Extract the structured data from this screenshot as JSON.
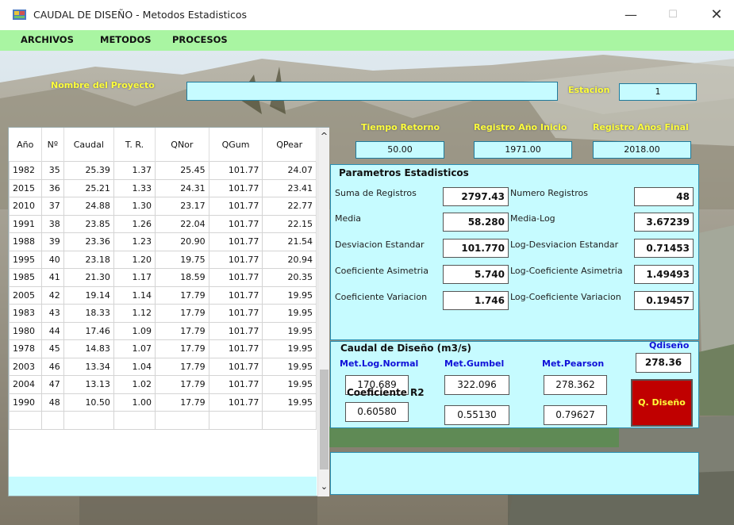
{
  "window": {
    "title": "CAUDAL DE DISEÑO - Metodos Estadisticos",
    "min_glyph": "—",
    "max_glyph": "☐",
    "close_glyph": "✕"
  },
  "menu": [
    "ARCHIVOS",
    "METODOS",
    "PROCESOS"
  ],
  "project": {
    "name_label": "Nombre del Proyecto",
    "name_value": "",
    "station_label": "Estacion",
    "station_value": "1"
  },
  "periods": {
    "return_label": "Tiempo Retorno",
    "return_value": "50.00",
    "start_label": "Registro Año Inicio",
    "start_value": "1971.00",
    "end_label": "Registro Años Final",
    "end_value": "2018.00"
  },
  "table": {
    "columns": [
      "Año",
      "Nº",
      "Caudal",
      "T. R.",
      "QNor",
      "QGum",
      "QPear"
    ],
    "rows": [
      [
        "1982",
        "35",
        "25.39",
        "1.37",
        "25.45",
        "101.77",
        "24.07"
      ],
      [
        "2015",
        "36",
        "25.21",
        "1.33",
        "24.31",
        "101.77",
        "23.41"
      ],
      [
        "2010",
        "37",
        "24.88",
        "1.30",
        "23.17",
        "101.77",
        "22.77"
      ],
      [
        "1991",
        "38",
        "23.85",
        "1.26",
        "22.04",
        "101.77",
        "22.15"
      ],
      [
        "1988",
        "39",
        "23.36",
        "1.23",
        "20.90",
        "101.77",
        "21.54"
      ],
      [
        "1995",
        "40",
        "23.18",
        "1.20",
        "19.75",
        "101.77",
        "20.94"
      ],
      [
        "1985",
        "41",
        "21.30",
        "1.17",
        "18.59",
        "101.77",
        "20.35"
      ],
      [
        "2005",
        "42",
        "19.14",
        "1.14",
        "17.79",
        "101.77",
        "19.95"
      ],
      [
        "1983",
        "43",
        "18.33",
        "1.12",
        "17.79",
        "101.77",
        "19.95"
      ],
      [
        "1980",
        "44",
        "17.46",
        "1.09",
        "17.79",
        "101.77",
        "19.95"
      ],
      [
        "1978",
        "45",
        "14.83",
        "1.07",
        "17.79",
        "101.77",
        "19.95"
      ],
      [
        "2003",
        "46",
        "13.34",
        "1.04",
        "17.79",
        "101.77",
        "19.95"
      ],
      [
        "2004",
        "47",
        "13.13",
        "1.02",
        "17.79",
        "101.77",
        "19.95"
      ],
      [
        "1990",
        "48",
        "10.50",
        "1.00",
        "17.79",
        "101.77",
        "19.95"
      ],
      [
        "",
        "",
        "",
        "",
        "",
        "",
        ""
      ]
    ],
    "scroll_up": "^",
    "scroll_down": "⌄"
  },
  "stats": {
    "title": "Parametros Estadisticos",
    "left": [
      {
        "label": "Suma de Registros",
        "value": "2797.43"
      },
      {
        "label": "Media",
        "value": "58.280"
      },
      {
        "label": "Desviacion Estandar",
        "value": "101.770"
      },
      {
        "label": "Coeficiente Asimetria",
        "value": "5.740"
      },
      {
        "label": "Coeficiente Variacion",
        "value": "1.746"
      }
    ],
    "right": [
      {
        "label": "Numero Registros",
        "value": "48"
      },
      {
        "label": "Media-Log",
        "value": "3.67239"
      },
      {
        "label": "Log-Desviacion Estandar",
        "value": "0.71453"
      },
      {
        "label": "Log-Coeficiente Asimetria",
        "value": "1.49493"
      },
      {
        "label": "Log-Coeficiente Variacion",
        "value": "0.19457"
      }
    ]
  },
  "flow": {
    "title": "Caudal de Diseño (m3/s)",
    "methods": [
      "Met.Log.Normal",
      "Met.Gumbel",
      "Met.Pearson"
    ],
    "values": [
      "170.689",
      "322.096",
      "278.362"
    ],
    "r2_label": "Coeficiente R2",
    "r2_values": [
      "0.60580",
      "0.55130",
      "0.79627"
    ],
    "qdesign_label": "Qdiseño",
    "qdesign_value": "278.36",
    "button_label": "Q. Diseño"
  },
  "colors": {
    "menu_bg": "#a9f5a2",
    "panel_bg": "#c6fbff",
    "label_yellow": "#ffff3a",
    "method_blue": "#1010d8",
    "button_red": "#c00000"
  }
}
